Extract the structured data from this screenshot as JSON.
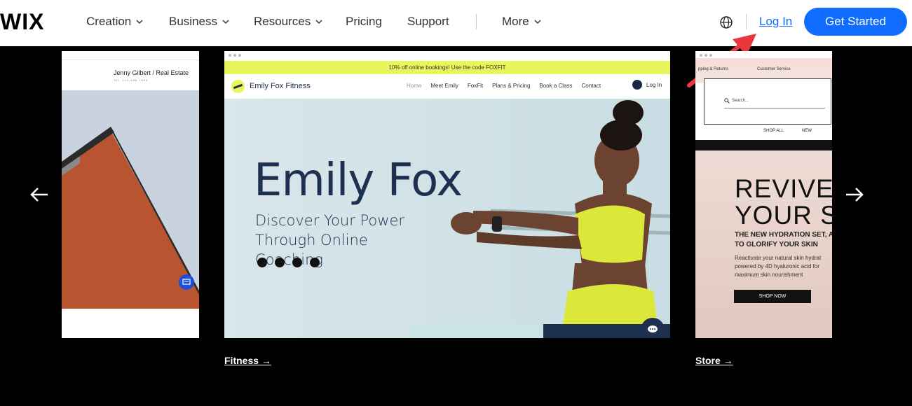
{
  "header": {
    "logo": "WIX",
    "nav": [
      {
        "label": "Creation",
        "dropdown": true
      },
      {
        "label": "Business",
        "dropdown": true
      },
      {
        "label": "Resources",
        "dropdown": true
      },
      {
        "label": "Pricing",
        "dropdown": false
      },
      {
        "label": "Support",
        "dropdown": false
      },
      {
        "label": "More",
        "dropdown": true
      }
    ],
    "login": "Log In",
    "cta": "Get Started"
  },
  "carousel": {
    "left": {
      "name": "Jenny Gilbert / Real Estate",
      "tel": "Tel: 123-456-7890"
    },
    "center": {
      "promo": "10% off online bookings! Use the code FOXFIT",
      "brand": "Emily Fox Fitness",
      "links": [
        "Home",
        "Meet Emily",
        "FoxFit",
        "Plans & Pricing",
        "Book a Class",
        "Contact"
      ],
      "login": "Log In",
      "title": "Emily Fox",
      "subtitle": "Discover Your Power Through Online Coaching",
      "caption": "Fitness →"
    },
    "right": {
      "menu1": "pping & Returns",
      "menu2": "Customer Service",
      "search": "Search...",
      "shop_all": "SHOP ALL",
      "new": "NEW",
      "title_line1": "REVIVE",
      "title_line2": "YOUR SK",
      "sub_line1": "THE NEW HYDRATION SET, A",
      "sub_line2": "TO GLORIFY YOUR SKIN",
      "body_line1": "Reactivate your natural skin hydrat",
      "body_line2": "powered by 4D hyaluronic acid for",
      "body_line3": "maximum skin nourishment",
      "button": "SHOP NOW",
      "caption": "Store →"
    }
  },
  "colors": {
    "accent": "#116dff",
    "annotation": "#e8383d",
    "background": "#000000"
  }
}
